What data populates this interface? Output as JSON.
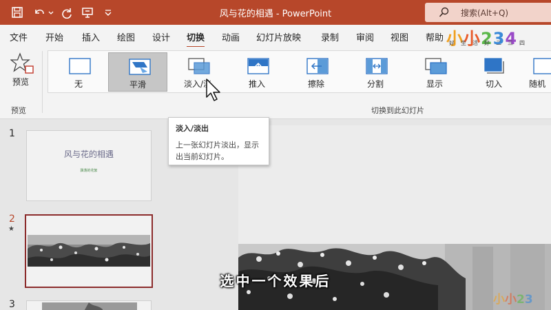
{
  "window": {
    "title": "风与花的相遇  -  PowerPoint",
    "search_label": "搜索(Alt+Q)",
    "accent": "#b7472a"
  },
  "quick_access": [
    {
      "icon": "save-icon"
    },
    {
      "icon": "undo-icon"
    },
    {
      "icon": "redo-icon"
    },
    {
      "icon": "presentation-icon"
    },
    {
      "icon": "customize-dropdown-icon"
    }
  ],
  "menu": {
    "tabs": [
      "文件",
      "开始",
      "插入",
      "绘图",
      "设计",
      "切换",
      "动画",
      "幻灯片放映",
      "录制",
      "审阅",
      "视图",
      "帮助"
    ],
    "active": "切换"
  },
  "ribbon": {
    "preview_label": "预览",
    "preview_group_label": "预览",
    "transitions_group_label": "切换到此幻灯片",
    "effects": [
      {
        "label": "无",
        "icon": "none-transition-icon"
      },
      {
        "label": "平滑",
        "icon": "morph-transition-icon",
        "selected": true
      },
      {
        "label": "淡入/淡",
        "icon": "fade-transition-icon"
      },
      {
        "label": "推入",
        "icon": "push-transition-icon"
      },
      {
        "label": "擦除",
        "icon": "wipe-transition-icon"
      },
      {
        "label": "分割",
        "icon": "split-transition-icon"
      },
      {
        "label": "显示",
        "icon": "reveal-transition-icon"
      },
      {
        "label": "切入",
        "icon": "cut-transition-icon"
      },
      {
        "label": "随机",
        "icon": "random-transition-icon"
      }
    ]
  },
  "tooltip": {
    "title": "淡入/淡出",
    "body": "上一张幻灯片淡出，显示出当前幻灯片。"
  },
  "slides": [
    {
      "number": "1",
      "title": "风与花的相遇",
      "subtitle": "飘荡的花絮"
    },
    {
      "number": "2",
      "marker": "★"
    },
    {
      "number": "3"
    }
  ],
  "logo": {
    "text": "小小234",
    "sub": "好生活好二三四"
  },
  "caption": "选中一个效果后"
}
